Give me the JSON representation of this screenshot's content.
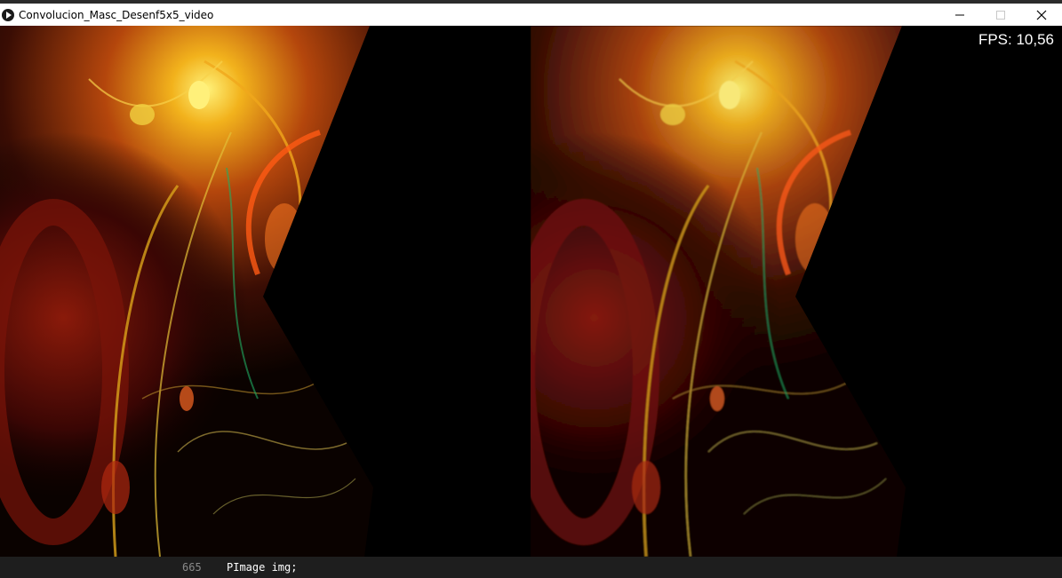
{
  "window": {
    "title": "Convolucion_Masc_Desenf5x5_video",
    "controls": [
      "minimize-icon",
      "maximize-icon",
      "close-icon"
    ]
  },
  "overlay": {
    "fps_label": "FPS: 10,56"
  },
  "editor": {
    "line_number": "665",
    "code": "PImage img;"
  },
  "colors": {
    "titlebar": "#ffffff",
    "canvas": "#000000",
    "editor_bg": "#1e1e1e",
    "fps_text": "#ffffff"
  }
}
